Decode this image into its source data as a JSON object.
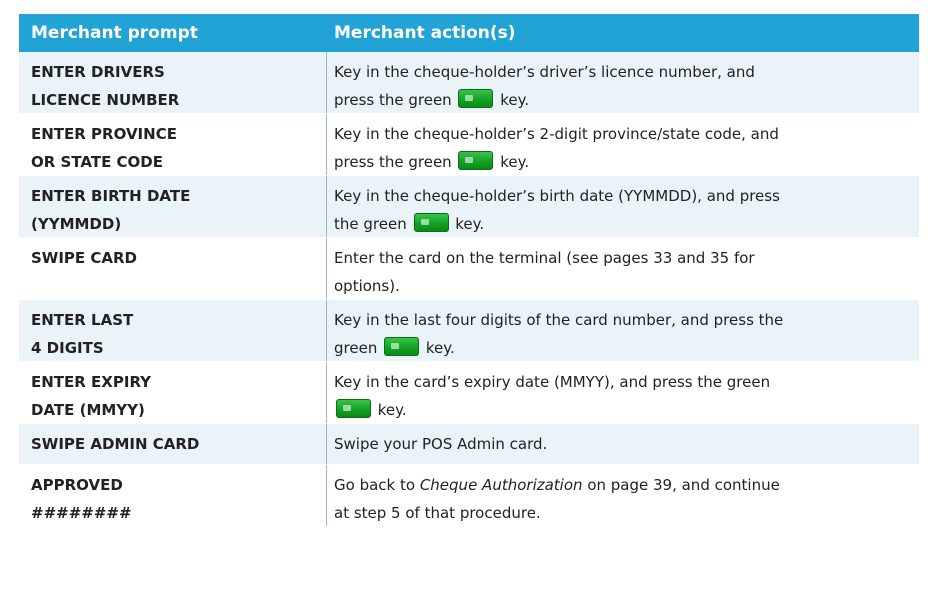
{
  "header": {
    "col1": "Merchant prompt",
    "col2": "Merchant action(s)"
  },
  "rows": [
    {
      "prompt_line1": "ENTER DRIVERS",
      "prompt_line2": "LICENCE NUMBER",
      "action_line1": "Key in the cheque-holder’s driver’s licence number, and",
      "action_line2_pre": "press the green",
      "action_line2_post": "key."
    },
    {
      "prompt_line1": "ENTER PROVINCE",
      "prompt_line2": "OR STATE CODE",
      "action_line1": "Key in the cheque-holder’s 2-digit province/state code, and",
      "action_line2_pre": "press the green",
      "action_line2_post": "key."
    },
    {
      "prompt_line1": "ENTER BIRTH DATE",
      "prompt_line2": "(YYMMDD)",
      "action_line1": "Key in the cheque-holder’s birth date (YYMMDD), and press",
      "action_line2_pre": "the green",
      "action_line2_post": "key."
    },
    {
      "prompt_line1": "SWIPE CARD",
      "action_line1": "Enter the card on the terminal (see pages 33 and 35 for",
      "action_line2": "options)."
    },
    {
      "prompt_line1": "ENTER LAST",
      "prompt_line2": "4 DIGITS",
      "action_line1": "Key in the last four digits of the card number, and press the",
      "action_line2_pre": "green",
      "action_line2_post": "key."
    },
    {
      "prompt_line1": "ENTER EXPIRY",
      "prompt_line2": "DATE (MMYY)",
      "action_line1": "Key in the card’s expiry date (MMYY), and press the green",
      "action_line2_pre": "",
      "action_line2_post": "key."
    },
    {
      "prompt_line1": "SWIPE ADMIN CARD",
      "action_line1": "Swipe your POS Admin card."
    },
    {
      "prompt_line1": "APPROVED",
      "prompt_line2": "########",
      "action_line1_pre": "Go back to",
      "action_line1_ital": "Cheque Authorization",
      "action_line1_post": "on page 39, and continue",
      "action_line2": "at step 5 of that procedure."
    }
  ],
  "colors": {
    "header_bg": "#22a3d5",
    "row_alt_bg": "#eaf3f8",
    "key_green": "#11a021"
  },
  "icons": {
    "green_key": "green-ok-key-icon"
  }
}
